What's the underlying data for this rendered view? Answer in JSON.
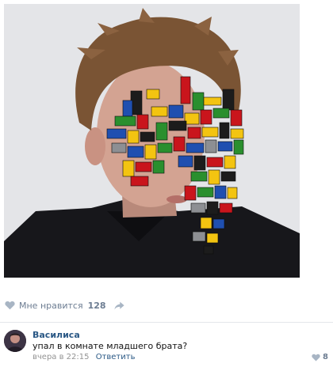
{
  "post": {
    "image_alt": "young man with lego bricks on face",
    "likes": {
      "label": "Мне нравится",
      "count": "128"
    }
  },
  "comment": {
    "author": "Василиса",
    "text": "упал в комнате младшего брата?",
    "time": "вчера в 22:15",
    "reply_label": "Ответить",
    "like_count": "8"
  },
  "colors": {
    "link": "#2a5885",
    "muted": "#6d7d92",
    "divider": "#e4e6ea"
  }
}
